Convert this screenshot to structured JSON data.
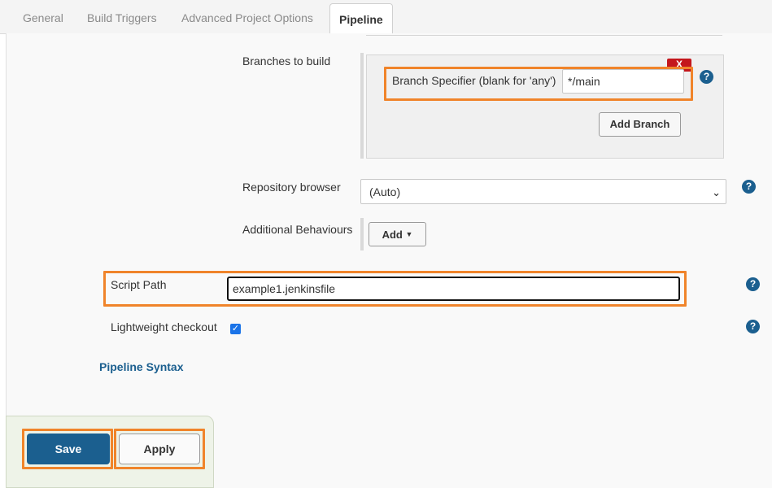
{
  "tabs": [
    {
      "label": "General"
    },
    {
      "label": "Build Triggers"
    },
    {
      "label": "Advanced Project Options"
    },
    {
      "label": "Pipeline"
    }
  ],
  "active_tab": "Pipeline",
  "branches": {
    "section_label": "Branches to build",
    "delete_label": "X",
    "specifier_label": "Branch Specifier (blank for 'any')",
    "specifier_value": "*/main",
    "add_branch_label": "Add Branch"
  },
  "repository_browser": {
    "label": "Repository browser",
    "selected": "(Auto)"
  },
  "additional_behaviours": {
    "label": "Additional Behaviours",
    "add_label": "Add"
  },
  "script_path": {
    "label": "Script Path",
    "value": "example1.jenkinsfile"
  },
  "lightweight_checkout": {
    "label": "Lightweight checkout",
    "checked": true
  },
  "pipeline_syntax_link": "Pipeline Syntax",
  "footer": {
    "save_label": "Save",
    "apply_label": "Apply"
  },
  "colors": {
    "accent": "#1b5f8f",
    "highlight": "#f0842a",
    "delete": "#c4161c"
  }
}
